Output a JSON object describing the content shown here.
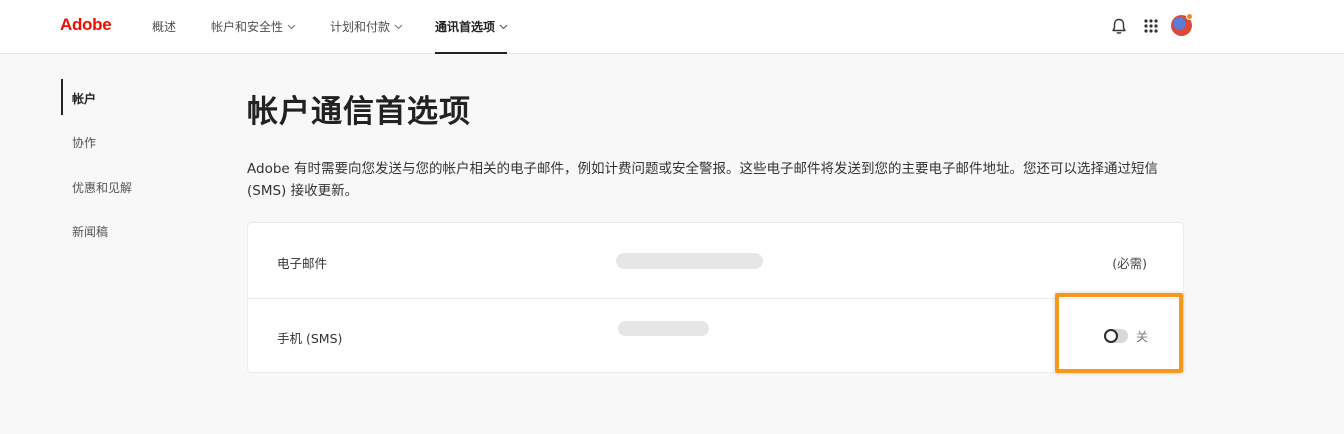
{
  "brand": {
    "name": "Adobe",
    "color": "#eb1000"
  },
  "nav": {
    "items": [
      {
        "label": "概述",
        "has_dropdown": false,
        "active": false
      },
      {
        "label": "帐户和安全性",
        "has_dropdown": true,
        "active": false
      },
      {
        "label": "计划和付款",
        "has_dropdown": true,
        "active": false
      },
      {
        "label": "通讯首选项",
        "has_dropdown": true,
        "active": true
      }
    ]
  },
  "header_icons": [
    "bell-icon",
    "app-grid-icon",
    "avatar"
  ],
  "sidebar": {
    "items": [
      {
        "label": "帐户",
        "active": true
      },
      {
        "label": "协作",
        "active": false
      },
      {
        "label": "优惠和见解",
        "active": false
      },
      {
        "label": "新闻稿",
        "active": false
      }
    ]
  },
  "main": {
    "title": "帐户通信首选项",
    "description": "Adobe 有时需要向您发送与您的帐户相关的电子邮件，例如计费问题或安全警报。这些电子邮件将发送到您的主要电子邮件地址。您还可以选择通过短信 (SMS) 接收更新。"
  },
  "card": {
    "rows": [
      {
        "label": "电子邮件",
        "status": "(必需)"
      },
      {
        "label": "手机 (SMS)",
        "toggle_state": "关",
        "toggle_on": false
      }
    ]
  },
  "colors": {
    "highlight": "#f6981c",
    "accent": "#eb1000"
  }
}
